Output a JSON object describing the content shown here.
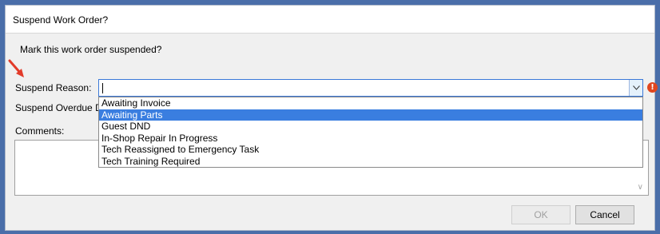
{
  "dialog": {
    "title": "Suspend Work Order?",
    "prompt": "Mark this work order suspended?"
  },
  "form": {
    "suspend_reason_label": "Suspend Reason:",
    "suspend_reason_value": "",
    "suspend_overdue_label": "Suspend Overdue D",
    "comments_label": "Comments:",
    "comments_value": ""
  },
  "dropdown": {
    "options": [
      "Awaiting Invoice",
      "Awaiting Parts",
      "Guest DND",
      "In-Shop Repair In Progress",
      "Tech Reassigned to Emergency Task",
      "Tech Training Required"
    ],
    "highlighted": "Awaiting Parts"
  },
  "buttons": {
    "ok": "OK",
    "cancel": "Cancel"
  },
  "icons": {
    "error": "exclamation-error-icon",
    "arrow": "red-arrow-icon",
    "dropdown": "chevron-down-icon"
  },
  "colors": {
    "highlight": "#3a7ee0",
    "error": "#e0461f",
    "arrow": "#e23b2a"
  }
}
